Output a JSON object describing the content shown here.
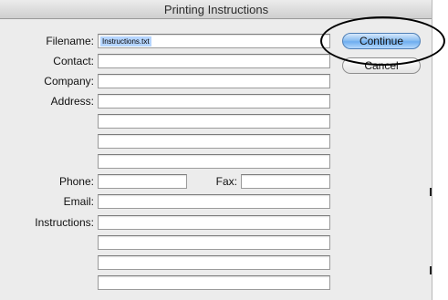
{
  "dialog": {
    "title": "Printing Instructions"
  },
  "form": {
    "filename_label": "Filename:",
    "filename_value": "Instructions.txt",
    "contact_label": "Contact:",
    "company_label": "Company:",
    "address_label": "Address:",
    "phone_label": "Phone:",
    "fax_label": "Fax:",
    "email_label": "Email:",
    "instructions_label": "Instructions:"
  },
  "buttons": {
    "continue_label": "Continue",
    "cancel_label": "Cancel"
  }
}
